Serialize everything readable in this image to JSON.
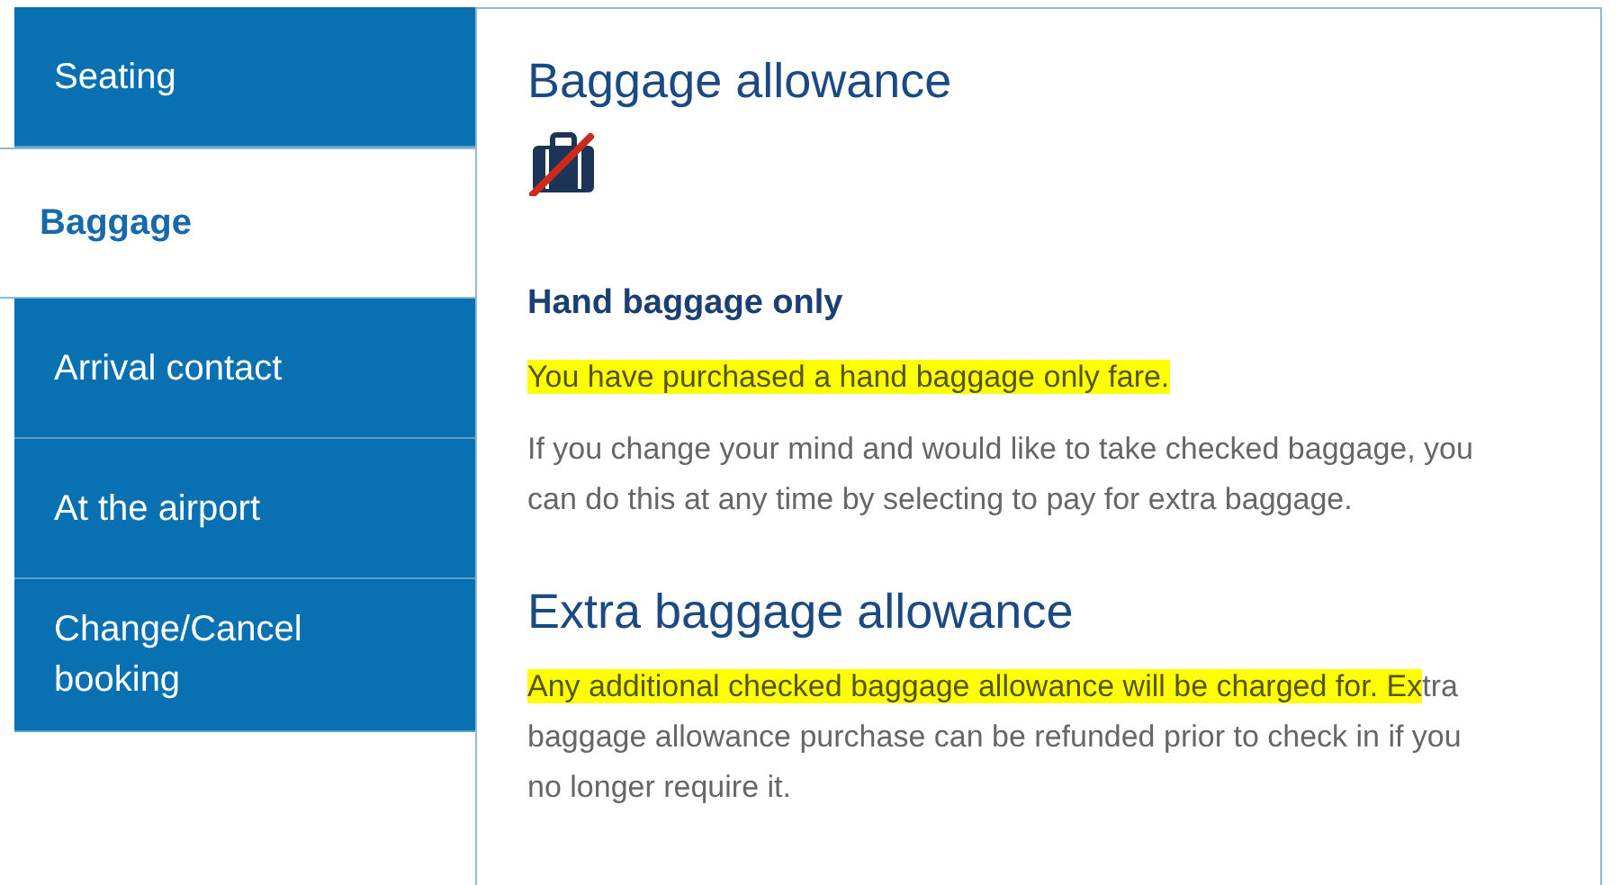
{
  "sidebar": {
    "items": [
      {
        "label": "Seating",
        "selected": false
      },
      {
        "label": "Baggage",
        "selected": true
      },
      {
        "label": "Arrival contact",
        "selected": false
      },
      {
        "label": "At the airport",
        "selected": false
      },
      {
        "label": "Change/Cancel booking",
        "selected": false
      }
    ]
  },
  "sections": [
    {
      "title": "Baggage allowance",
      "subtitle": "Hand baggage only",
      "paragraphs": [
        [
          {
            "text": "You have purchased a hand baggage only fare.",
            "highlighted": true
          }
        ],
        [
          {
            "text": "If you change your mind and would like to take checked baggage, you can do this at any time by selecting to pay for extra baggage.",
            "highlighted": false
          }
        ]
      ]
    },
    {
      "title": "Extra baggage allowance",
      "paragraphs": [
        [
          {
            "text": "Any additional checked baggage allowance will be charged for. Ex",
            "highlighted": true
          },
          {
            "text": "tra baggage allowance purchase can be refunded prior to check in if you no longer require it.",
            "highlighted": false
          }
        ]
      ]
    }
  ]
}
